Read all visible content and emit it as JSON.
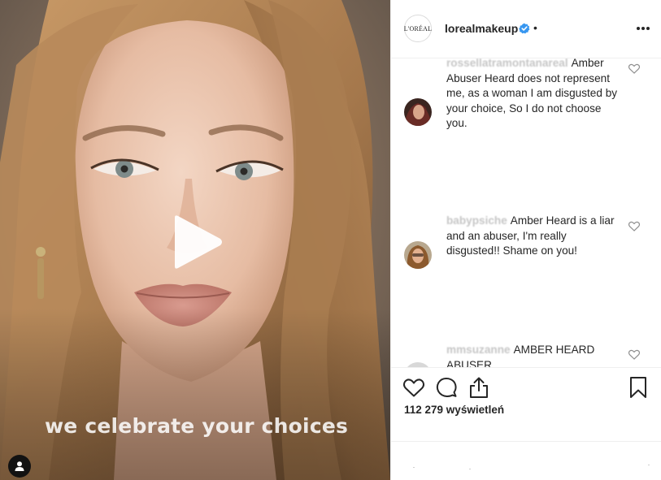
{
  "media": {
    "caption_overlay": "we celebrate your choices",
    "play_icon": "play-icon",
    "tag_icon": "user-tag-icon"
  },
  "header": {
    "avatar_text": "L'ORÉAL",
    "username": "lorealmakeup",
    "separator": "•",
    "verified_color": "#3897f0"
  },
  "comments": [
    {
      "user": "rossellatramontanareal",
      "text": "Amber Abuser Heard does not represent me, as a woman I am disgusted by your choice, So I do not choose you."
    },
    {
      "user": "babypsiche",
      "text": "Amber Heard is a liar and an abuser, I'm really disgusted!! Shame on you!"
    },
    {
      "user": "mmsuzanne",
      "text": "AMBER HEARD ABUSER"
    }
  ],
  "actions": {
    "like_icon": "heart-icon",
    "comment_icon": "comment-icon",
    "share_icon": "share-icon",
    "save_icon": "bookmark-icon",
    "views": "112 279 wyświetleń"
  }
}
